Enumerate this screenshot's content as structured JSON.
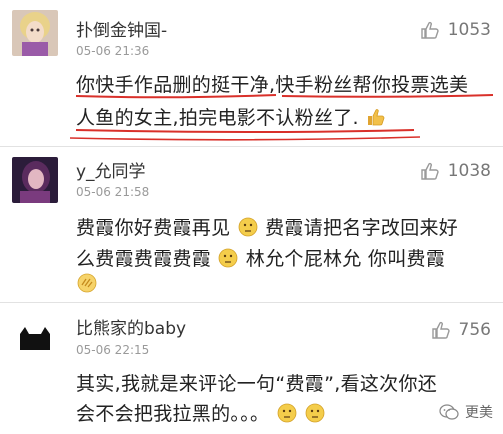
{
  "comments": [
    {
      "username": "扑倒金钟国-",
      "time": "05-06 21:36",
      "likes": "1053",
      "avatar": "doll-portrait-avatar",
      "lines": [
        "你快手作品删的挺干净,快手粉丝帮你投票选美",
        "人鱼的女主,拍完电影不认粉丝了."
      ],
      "emoji_trail": "thumbs-up-emoji"
    },
    {
      "username": "y_允同学",
      "time": "05-06 21:58",
      "likes": "1038",
      "avatar": "girl-photo-avatar",
      "line1_a": "费霞你好费霞再见",
      "line1_b": "费霞请把名字改回来好",
      "line2_a": "么费霞费霞费霞",
      "line2_b": "林允个屁林允  你叫费霞"
    },
    {
      "username": "比熊家的baby",
      "time": "05-06 22:15",
      "likes": "756",
      "avatar": "black-cat-avatar",
      "lines": [
        "其实,我就是来评论一句“费霞”,看这次你还",
        "会不会把我拉黑的。。。"
      ]
    }
  ],
  "watermark": {
    "label": "更美",
    "icon": "wechat-icon"
  },
  "colors": {
    "underline": "#d9302a",
    "like_icon": "#9a9a9a"
  }
}
